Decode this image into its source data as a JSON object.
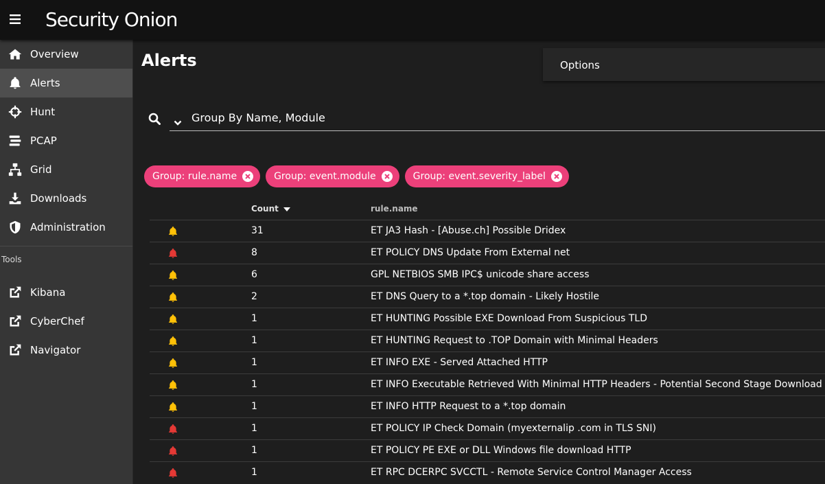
{
  "app": {
    "logo_text": "Security Onion"
  },
  "sidebar": {
    "items": [
      {
        "label": "Overview",
        "icon": "home-icon"
      },
      {
        "label": "Alerts",
        "icon": "bell-icon",
        "active": true
      },
      {
        "label": "Hunt",
        "icon": "crosshairs-icon"
      },
      {
        "label": "PCAP",
        "icon": "stream-icon"
      },
      {
        "label": "Grid",
        "icon": "sitemap-icon"
      },
      {
        "label": "Downloads",
        "icon": "download-icon"
      },
      {
        "label": "Administration",
        "icon": "shield-icon"
      }
    ],
    "tools_header": "Tools",
    "tools": [
      {
        "label": "Kibana",
        "icon": "external-link-icon"
      },
      {
        "label": "CyberChef",
        "icon": "external-link-icon"
      },
      {
        "label": "Navigator",
        "icon": "external-link-icon"
      }
    ]
  },
  "main": {
    "title": "Alerts",
    "options_label": "Options",
    "query": "Group By Name, Module",
    "chips": [
      "Group: rule.name",
      "Group: event.module",
      "Group: event.severity_label"
    ],
    "table": {
      "headers": {
        "count": "Count",
        "rule": "rule.name"
      },
      "rows": [
        {
          "severity": "medium",
          "count": "31",
          "rule": "ET JA3 Hash - [Abuse.ch] Possible Dridex"
        },
        {
          "severity": "high",
          "count": "8",
          "rule": "ET POLICY DNS Update From External net"
        },
        {
          "severity": "medium",
          "count": "6",
          "rule": "GPL NETBIOS SMB IPC$ unicode share access"
        },
        {
          "severity": "medium",
          "count": "2",
          "rule": "ET DNS Query to a *.top domain - Likely Hostile"
        },
        {
          "severity": "medium",
          "count": "1",
          "rule": "ET HUNTING Possible EXE Download From Suspicious TLD"
        },
        {
          "severity": "medium",
          "count": "1",
          "rule": "ET HUNTING Request to .TOP Domain with Minimal Headers"
        },
        {
          "severity": "medium",
          "count": "1",
          "rule": "ET INFO EXE - Served Attached HTTP"
        },
        {
          "severity": "medium",
          "count": "1",
          "rule": "ET INFO Executable Retrieved With Minimal HTTP Headers - Potential Second Stage Download"
        },
        {
          "severity": "medium",
          "count": "1",
          "rule": "ET INFO HTTP Request to a *.top domain"
        },
        {
          "severity": "high",
          "count": "1",
          "rule": "ET POLICY IP Check Domain (myexternalip .com in TLS SNI)"
        },
        {
          "severity": "high",
          "count": "1",
          "rule": "ET POLICY PE EXE or DLL Windows file download HTTP"
        },
        {
          "severity": "high",
          "count": "1",
          "rule": "ET RPC DCERPC SVCCTL - Remote Service Control Manager Access"
        }
      ]
    }
  },
  "colors": {
    "chip": "#ec407a",
    "medium": "#ffc107",
    "high": "#e53935"
  }
}
